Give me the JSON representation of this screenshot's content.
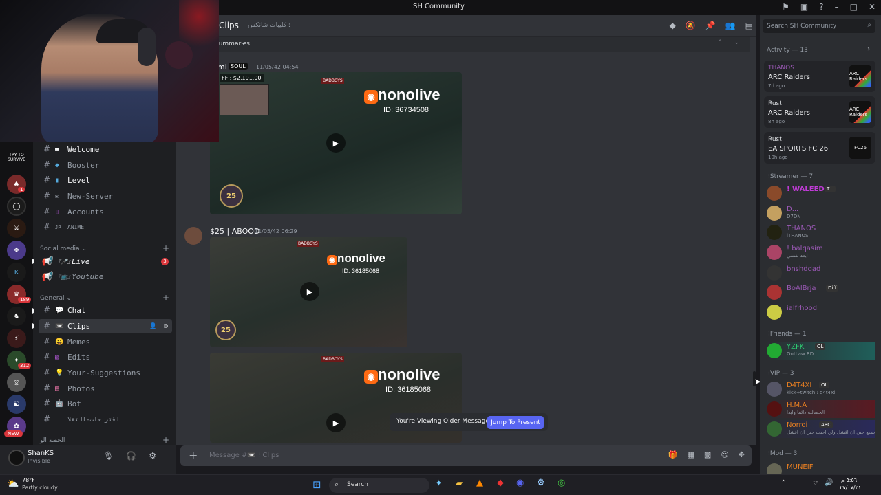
{
  "window": {
    "title": "SH Community"
  },
  "header": {
    "channel_name": "Clips",
    "channel_topic": "كليبات شانكس :"
  },
  "summaries": {
    "label": "Summaries"
  },
  "messages": [
    {
      "author": "mi",
      "badge": "SOUL",
      "timestamp": "11/05/42 04:54",
      "ffi": "FFI: $2,191.00",
      "video": {
        "brand": "nonolive",
        "id": "ID: 36734508",
        "tag": "BADBOYS",
        "level": "25"
      }
    },
    {
      "author": "$25 | ABOOD",
      "timestamp": "11/05/42 06:29",
      "video": {
        "brand": "nonolive",
        "id": "ID: 36185068",
        "tag": "BADBOYS",
        "level": "25"
      }
    },
    {
      "video": {
        "brand": "nonolive",
        "id": "ID: 36185068",
        "tag": "BADBOYS"
      }
    }
  ],
  "older_messages": {
    "text": "You're Viewing Older Messages",
    "jump_label": "Jump To Present"
  },
  "composer": {
    "placeholder": "Message #📼 ⁝ Clips"
  },
  "channels": {
    "top": [
      {
        "emoji": "▬",
        "name": "Welcome",
        "bold": true
      },
      {
        "emoji": "◆",
        "name": "Booster"
      },
      {
        "emoji": "▮",
        "name": "Level",
        "bold": true
      },
      {
        "emoji": "✉",
        "name": "New-Server"
      },
      {
        "emoji": "▯",
        "name": "Accounts"
      },
      {
        "emoji": "JP",
        "name": "ANIME"
      }
    ],
    "social_category": "Social media ⌄",
    "social": [
      {
        "emoji": "『🎤』",
        "name": "Live",
        "badge": "3"
      },
      {
        "emoji": "『📺』",
        "name": "Youtube"
      }
    ],
    "general_category": "General ⌄",
    "general": [
      {
        "emoji": "💬",
        "name": "Chat",
        "bold": true
      },
      {
        "emoji": "📼",
        "name": "Clips",
        "selected": true
      },
      {
        "emoji": "😀",
        "name": "Memes"
      },
      {
        "emoji": "▧",
        "name": "Edits"
      },
      {
        "emoji": "💡",
        "name": "Your-Suggestions"
      },
      {
        "emoji": "▤",
        "name": "Photos"
      },
      {
        "emoji": "🤖",
        "name": "Bot"
      },
      {
        "emoji": "",
        "name": "اقتراحات-التقلا"
      }
    ],
    "bottom_category": "الحصه الو"
  },
  "servers": {
    "badges": [
      "1",
      "189",
      "312"
    ],
    "new_label": "NEW",
    "try_label": "TRY TO SURVIVE"
  },
  "user": {
    "name": "ShanKS",
    "status": "Invisible"
  },
  "search": {
    "placeholder": "Search SH Community"
  },
  "activity": {
    "title": "Activity — 13",
    "items": [
      {
        "user": "THANOS",
        "game": "ARC Raiders",
        "ago": "7d ago",
        "thumb": "ARC Raiders"
      },
      {
        "user": "Rust",
        "game": "ARC Raiders",
        "ago": "8h ago",
        "thumb": "ARC Raiders"
      },
      {
        "user": "Rust",
        "game": "EA SPORTS FC 26",
        "ago": "10h ago",
        "thumb": "FC26"
      }
    ]
  },
  "members": {
    "streamer_title": "⁝Streamer — 7",
    "streamer": [
      {
        "name": "! WALEED",
        "tag": "T.L",
        "sub": "",
        "color": "#c03bd6"
      },
      {
        "name": "D...",
        "tag": "",
        "sub": "D7DN",
        "color": "#9b59b6"
      },
      {
        "name": "THANOS",
        "tag": "",
        "sub": "iTHANOS",
        "color": "#9b59b6"
      },
      {
        "name": "! balqasim",
        "tag": "",
        "sub": "ابعد نفسي",
        "color": "#9b59b6"
      },
      {
        "name": "bnshddad",
        "tag": "",
        "sub": "",
        "color": "#9b59b6"
      },
      {
        "name": "BoAlBrja",
        "tag": "Diff",
        "sub": "",
        "color": "#9b59b6"
      },
      {
        "name": "ialfrhood",
        "tag": "",
        "sub": "",
        "color": "#9b59b6"
      }
    ],
    "friends_title": "⁝Friends — 1",
    "friends": [
      {
        "name": "YZFK",
        "tag": "OL",
        "sub": "OutLaw RD",
        "color": "#2ecc71"
      }
    ],
    "vip_title": "⁝VIP — 3",
    "vip": [
      {
        "name": "D4T4XI",
        "tag": "OL",
        "sub": "kick+twitch : d4t4xi",
        "color": "#e67e22"
      },
      {
        "name": "H.M.A",
        "tag": "",
        "sub": "الحمدلله دائما وابدا",
        "color": "#e67e22"
      },
      {
        "name": "Norroi",
        "tag": "ARC",
        "sub": "للجميع حين ان افشل ولن احبب حين ان افشل",
        "color": "#e67e22"
      }
    ],
    "mod_title": "⁝Mod — 3",
    "mod": [
      {
        "name": "MUNEIF",
        "tag": "",
        "sub": "",
        "color": "#e67e22"
      }
    ]
  },
  "taskbar": {
    "weather_temp": "78°F",
    "weather_desc": "Partly cloudy",
    "search_label": "Search",
    "time": "٥:٥٦ م",
    "date": "٢٧/٠٧/٢١"
  },
  "colors": {
    "accent": "#5865f2",
    "danger": "#da373c",
    "nonolive": "#ff6a13"
  }
}
